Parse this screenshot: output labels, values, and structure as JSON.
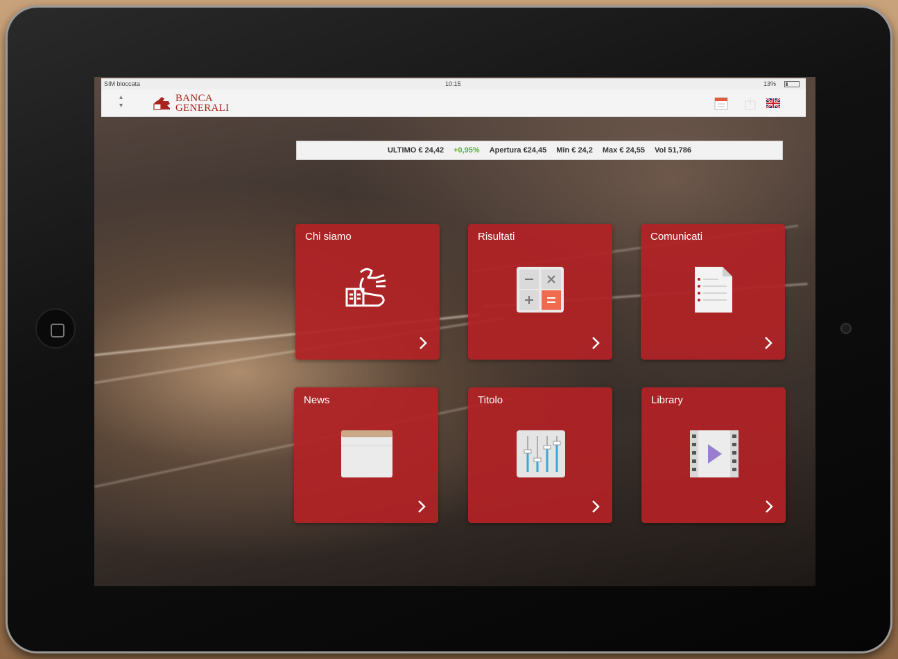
{
  "status_bar": {
    "carrier": "SIM bloccata",
    "time": "10:15",
    "battery": "13%"
  },
  "nav_bar": {
    "logo_line1": "BANCA",
    "logo_line2": "GENERALI",
    "icons": [
      "calendar-icon",
      "share-icon",
      "uk-flag-icon"
    ]
  },
  "ticker": {
    "last_label": "ULTIMO",
    "last_value": "€ 24,42",
    "change": "+0,95%",
    "open_label": "Apertura",
    "open_value": "€24,45",
    "min_label": "Min",
    "min_value": "€ 24,2",
    "max_label": "Max",
    "max_value": "€ 24,55",
    "vol_label": "Vol",
    "vol_value": "51,786"
  },
  "tiles": [
    {
      "label": "Chi siamo",
      "icon": "lion-logo-icon"
    },
    {
      "label": "Risultati",
      "icon": "calculator-icon"
    },
    {
      "label": "Comunicati",
      "icon": "document-icon"
    },
    {
      "label": "News",
      "icon": "newspaper-icon"
    },
    {
      "label": "Titolo",
      "icon": "equalizer-icon"
    },
    {
      "label": "Library",
      "icon": "video-icon"
    }
  ],
  "colors": {
    "tile_red": "#b22226",
    "brand_red": "#a8241f",
    "positive_green": "#5fae3a",
    "calculator_orange": "#f06a4d",
    "video_purple": "#9a7fd0"
  }
}
